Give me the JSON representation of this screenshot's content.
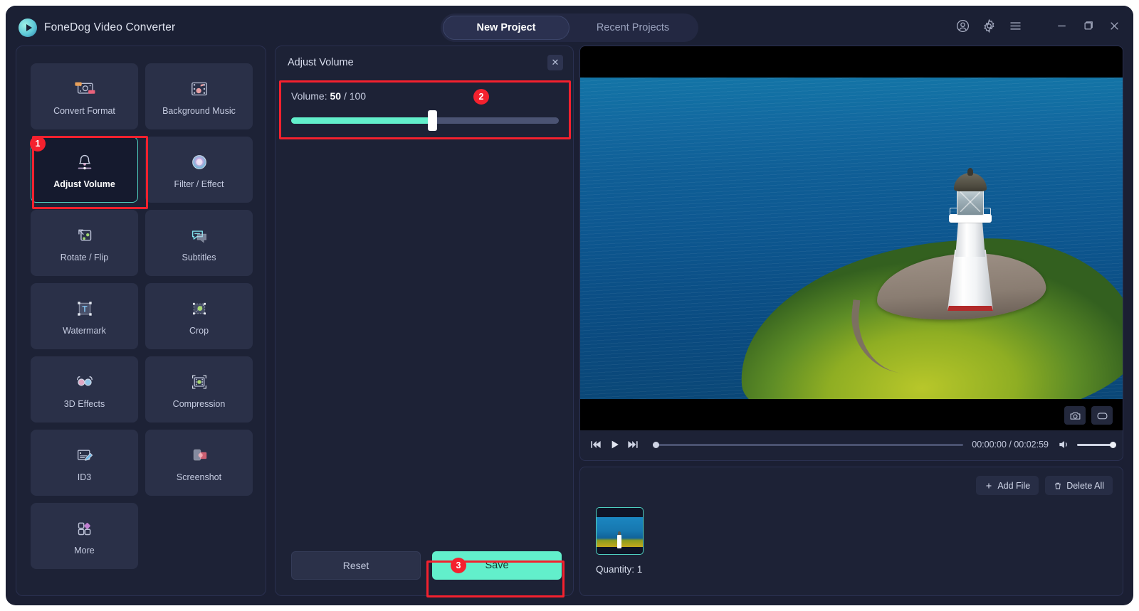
{
  "app": {
    "title": "FoneDog Video Converter",
    "logo_icon": "play-circle-logo"
  },
  "titlebar": {
    "tabs": [
      {
        "label": "New Project",
        "active": true
      },
      {
        "label": "Recent Projects",
        "active": false
      }
    ],
    "icons": [
      {
        "name": "account-icon",
        "glyph": "user-circle"
      },
      {
        "name": "settings-icon",
        "glyph": "gear"
      },
      {
        "name": "menu-icon",
        "glyph": "hamburger"
      },
      {
        "name": "minimize-icon",
        "glyph": "minus"
      },
      {
        "name": "maximize-icon",
        "glyph": "restore"
      },
      {
        "name": "close-icon",
        "glyph": "cross"
      }
    ]
  },
  "sidebar": {
    "tools": [
      {
        "label": "Convert Format",
        "icon": "convert-format-icon",
        "selected": false
      },
      {
        "label": "Background Music",
        "icon": "background-music-icon",
        "selected": false
      },
      {
        "label": "Adjust Volume",
        "icon": "adjust-volume-icon",
        "selected": true
      },
      {
        "label": "Filter / Effect",
        "icon": "filter-effect-icon",
        "selected": false
      },
      {
        "label": "Rotate / Flip",
        "icon": "rotate-flip-icon",
        "selected": false
      },
      {
        "label": "Subtitles",
        "icon": "subtitles-icon",
        "selected": false
      },
      {
        "label": "Watermark",
        "icon": "watermark-icon",
        "selected": false
      },
      {
        "label": "Crop",
        "icon": "crop-icon",
        "selected": false
      },
      {
        "label": "3D Effects",
        "icon": "three-d-effects-icon",
        "selected": false
      },
      {
        "label": "Compression",
        "icon": "compression-icon",
        "selected": false
      },
      {
        "label": "ID3",
        "icon": "id3-icon",
        "selected": false
      },
      {
        "label": "Screenshot",
        "icon": "screenshot-icon",
        "selected": false
      },
      {
        "label": "More",
        "icon": "more-icon",
        "selected": false
      }
    ]
  },
  "panel": {
    "title": "Adjust Volume",
    "close_label": "✕",
    "volume": {
      "prefix": "Volume: ",
      "value": "50",
      "suffix": " / 100",
      "current": 50,
      "max": 100,
      "fill_percent": 52
    },
    "reset_label": "Reset",
    "save_label": "Save"
  },
  "annotations": [
    {
      "number": "1",
      "target": "adjust-volume-tool"
    },
    {
      "number": "2",
      "target": "volume-slider-region"
    },
    {
      "number": "3",
      "target": "save-button"
    }
  ],
  "player": {
    "current_time": "00:00:00",
    "duration": "00:02:59",
    "time_display": "00:00:00 / 00:02:59",
    "seek_percent": 0,
    "volume_percent": 100,
    "buttons": [
      {
        "name": "previous-frame-button",
        "glyph": "skip-back"
      },
      {
        "name": "play-button",
        "glyph": "play"
      },
      {
        "name": "next-frame-button",
        "glyph": "skip-forward"
      }
    ],
    "overlay_buttons": [
      {
        "name": "snapshot-camera-button",
        "glyph": "camera"
      },
      {
        "name": "gif-capture-button",
        "glyph": "rounded-rect"
      }
    ],
    "mute_icon": "speaker-icon",
    "preview_alt": "lighthouse on a coastal headland above the ocean"
  },
  "filelist": {
    "add_file_label": "Add File",
    "add_file_icon": "plus-icon",
    "delete_all_label": "Delete All",
    "delete_all_icon": "trash-icon",
    "quantity_label": "Quantity: 1",
    "items": [
      {
        "name": "file-thumbnail",
        "selected": true
      }
    ]
  },
  "colors": {
    "accent": "#62efcb",
    "annotation_red": "#f4212e",
    "panel_bg": "#1d2236",
    "window_bg": "#1b1f33",
    "tile_bg": "#2a3048",
    "selected_tile_bg": "#151a2e"
  }
}
